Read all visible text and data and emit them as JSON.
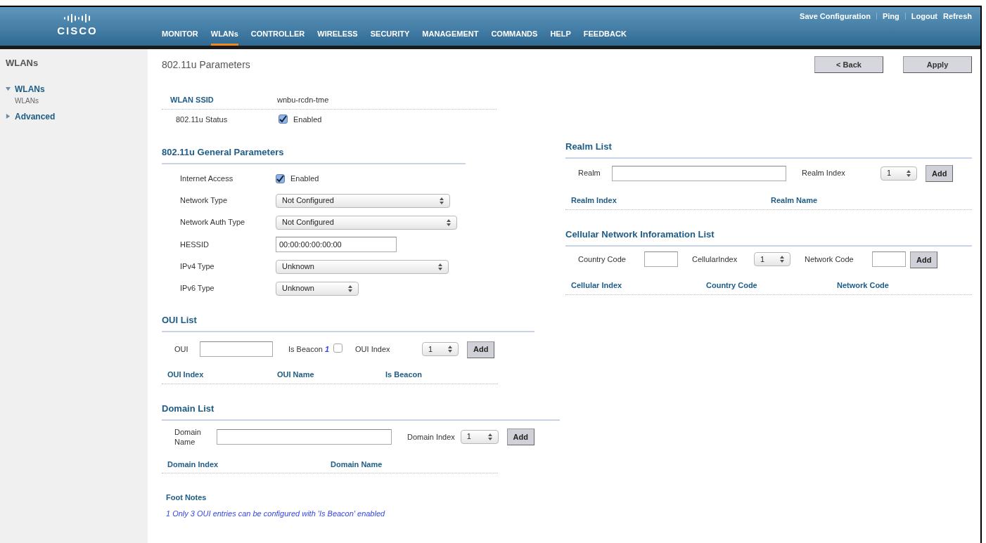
{
  "header": {
    "logo": "CISCO",
    "top_links": [
      "Save Configuration",
      "Ping",
      "Logout",
      "Refresh"
    ],
    "nav": [
      {
        "label": "MONITOR",
        "selected": false
      },
      {
        "label": "WLANs",
        "selected": true
      },
      {
        "label": "CONTROLLER",
        "selected": false
      },
      {
        "label": "WIRELESS",
        "selected": false
      },
      {
        "label": "SECURITY",
        "selected": false
      },
      {
        "label": "MANAGEMENT",
        "selected": false
      },
      {
        "label": "COMMANDS",
        "selected": false
      },
      {
        "label": "HELP",
        "selected": false
      },
      {
        "label": "FEEDBACK",
        "selected": false
      }
    ]
  },
  "sidebar": {
    "title": "WLANs",
    "items": [
      {
        "label": "WLANs",
        "expanded": true,
        "children": [
          {
            "label": "WLANs"
          }
        ]
      },
      {
        "label": "Advanced",
        "expanded": false
      }
    ]
  },
  "page_title": "802.11u Parameters",
  "buttons": [
    "< Back",
    "Apply"
  ],
  "wlan_ssid": {
    "label": "WLAN SSID",
    "value": "wnbu-rcdn-tme"
  },
  "status": {
    "label": "802.11u Status",
    "checked": true,
    "text": "Enabled"
  },
  "general": {
    "title": "802.11u General Parameters",
    "rows": [
      {
        "kind": "checkbox",
        "label": "Internet Access",
        "checked": true,
        "text": "Enabled"
      },
      {
        "kind": "select",
        "label": "Network Type",
        "value": "Not Configured"
      },
      {
        "kind": "select",
        "label": "Network Auth Type",
        "value": "Not Configured"
      },
      {
        "kind": "text",
        "label": "HESSID",
        "value": "00:00:00:00:00:00"
      },
      {
        "kind": "select",
        "label": "IPv4 Type",
        "value": "Unknown"
      },
      {
        "kind": "select",
        "label": "IPv6 Type",
        "value": "Unknown"
      }
    ]
  },
  "oui_list": {
    "title": "OUI List",
    "oui_label": "OUI",
    "beacon_label": "Is Beacon",
    "footnote_ref": "1",
    "beacon_checked": false,
    "index_label": "OUI Index",
    "index_value": "1",
    "add": "Add",
    "columns": [
      "OUI Index",
      "OUI Name",
      "Is Beacon"
    ]
  },
  "domain_list": {
    "title": "Domain List",
    "name_label": "Domain Name",
    "index_label": "Domain Index",
    "index_value": "1",
    "add": "Add",
    "columns": [
      "Domain Index",
      "Domain Name"
    ]
  },
  "foot_notes": {
    "title": "Foot Notes",
    "items": [
      "1 Only 3 OUI entries can be configured with 'Is Beacon' enabled"
    ]
  },
  "realm_list": {
    "title": "Realm List",
    "realm_label": "Realm",
    "index_label": "Realm Index",
    "index_value": "1",
    "add": "Add",
    "columns": [
      "Realm Index",
      "Realm Name"
    ]
  },
  "cellular_list": {
    "title": "Cellular Network Inforamation List",
    "country_label": "Country Code",
    "index_label": "CellularIndex",
    "index_value": "1",
    "network_label": "Network Code",
    "add": "Add",
    "columns": [
      "Cellular Index",
      "Country Code",
      "Network Code"
    ]
  }
}
